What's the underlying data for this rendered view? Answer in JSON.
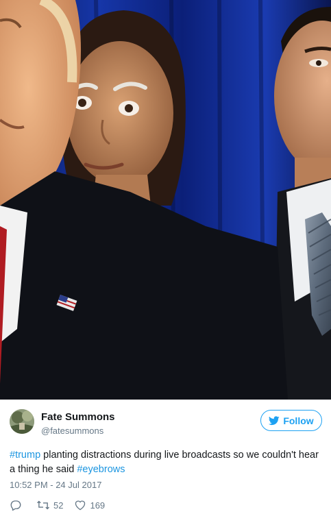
{
  "tweet": {
    "display_name": "Fate Summons",
    "handle": "@fatesummons",
    "follow_label": "Follow",
    "text": {
      "hashtag1": "#trump",
      "body": " planting distractions during live broadcasts so we couldn't hear a thing he said ",
      "hashtag2": "#eyebrows"
    },
    "timestamp": "10:52 PM - 24 Jul 2017",
    "retweets": "52",
    "likes": "169"
  },
  "colors": {
    "brand_blue": "#1da1f2",
    "link_blue": "#1b95e0",
    "muted": "#657786"
  },
  "icons": [
    "twitter-bird-icon",
    "reply-icon",
    "retweet-icon",
    "heart-icon"
  ]
}
